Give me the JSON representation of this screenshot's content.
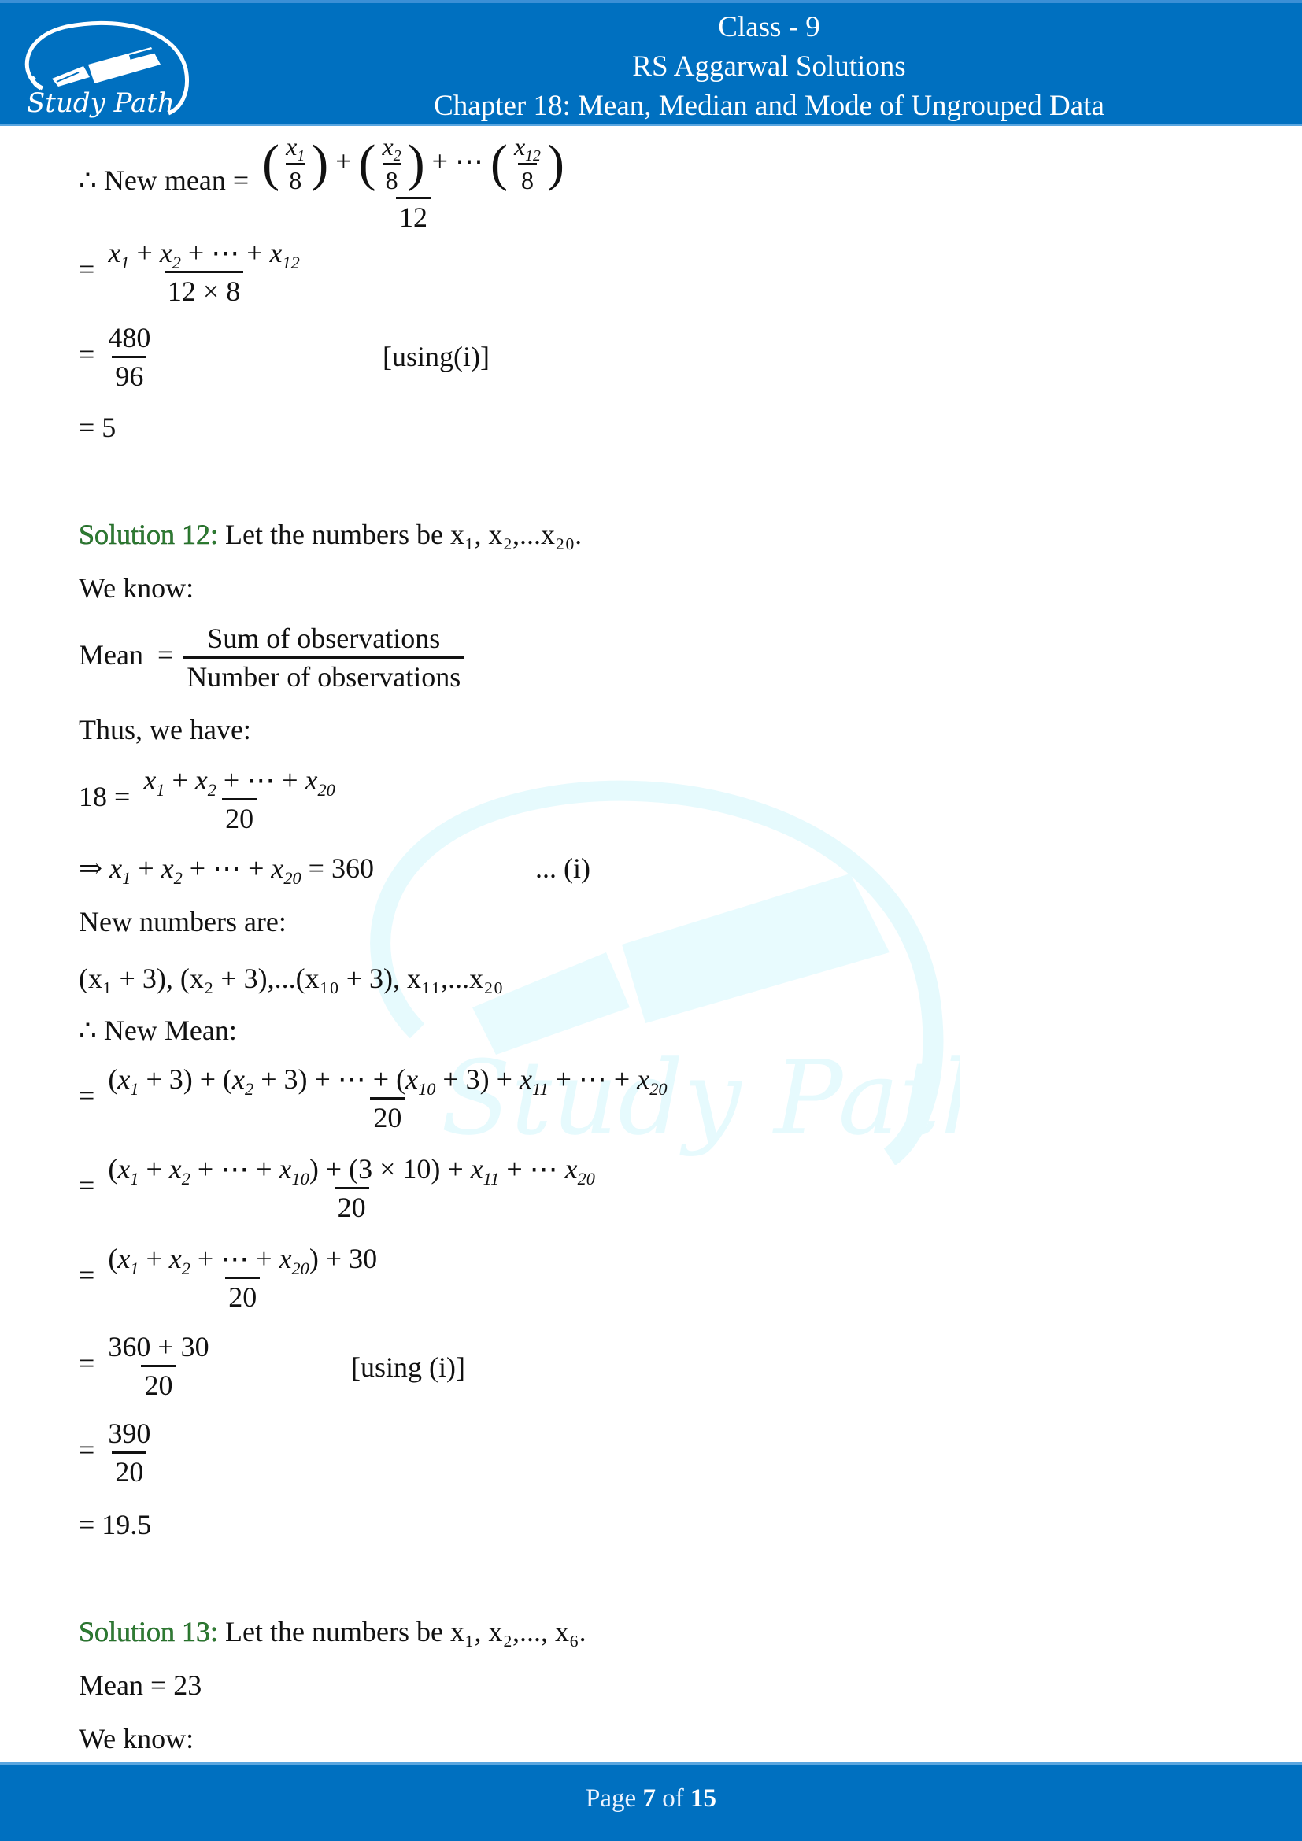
{
  "header": {
    "class_line": "Class - 9",
    "book_line": "RS Aggarwal Solutions",
    "chapter_line": "Chapter 18: Mean, Median and Mode of Ungrouped Data",
    "logo_text": "Study Path",
    "logo_icon": "fountain-pen-icon"
  },
  "footer": {
    "page_prefix": "Page",
    "page_current": "7",
    "page_of": "of",
    "page_total": "15"
  },
  "theme": {
    "header_bg": "#0070c0",
    "solution_label_color": "#2e7d32",
    "watermark_color": "#e6fafd"
  },
  "watermark": {
    "text": "Study Path"
  },
  "solution11_tail": {
    "intro": "∴ New mean =",
    "frac_den": "12",
    "step2_den": "12 × 8",
    "step3_num": "480",
    "step3_den": "96",
    "step3_note": "[using(i)]",
    "result": "= 5"
  },
  "solution12": {
    "label": "Solution 12:",
    "intro": "Let the numbers be x₁, x₂,...x₂₀.",
    "we_know": "We know:",
    "mean_label": "Mean",
    "mean_num": "Sum of observations",
    "mean_den": "Number of observations",
    "thus": "Thus, we have:",
    "eq1_lhs": "18 =",
    "eq1_den": "20",
    "eq2_rhs": "= 360",
    "eq2_note": "... (i)",
    "new_numbers_label": "New numbers are:",
    "new_numbers": "(x₁ + 3), (x₂ + 3),...(x₁₀ + 3), x₁₁,...x₂₀",
    "new_mean_label": "∴ New Mean:",
    "step1_den": "20",
    "step2_den": "20",
    "step3_den": "20",
    "step4_num": "360 + 30",
    "step4_den": "20",
    "step4_note": "[using (i)]",
    "step5_num": "390",
    "step5_den": "20",
    "result": "= 19.5"
  },
  "solution13": {
    "label": "Solution 13:",
    "intro": "Let the numbers be x₁, x₂,..., x₆.",
    "mean_line": "Mean = 23",
    "we_know": "We know:"
  }
}
